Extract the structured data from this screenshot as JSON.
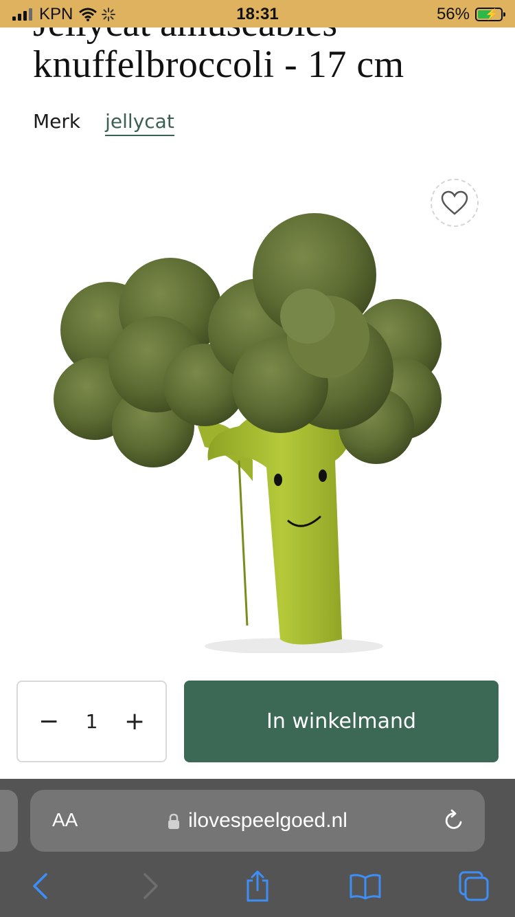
{
  "status_bar": {
    "carrier": "KPN",
    "time": "18:31",
    "battery": "56%"
  },
  "product": {
    "title_prev_line": "Jellycat amuseables",
    "title": "knuffelbroccoli - 17 cm",
    "brand_label": "Merk",
    "brand_name": "jellycat",
    "image_alt": "Jellycat broccoli plush toy"
  },
  "purchase": {
    "quantity": "1",
    "minus": "−",
    "plus": "+",
    "cart_label": "In winkelmand",
    "accent_color": "#3c6955"
  },
  "browser": {
    "aa_label": "AA",
    "url": "ilovespeelgoed.nl"
  },
  "icons": [
    "signal-icon",
    "wifi-icon",
    "battery-icon",
    "heart-icon",
    "lock-icon",
    "reload-icon",
    "back-icon",
    "forward-icon",
    "share-icon",
    "bookmarks-icon",
    "tabs-icon"
  ]
}
